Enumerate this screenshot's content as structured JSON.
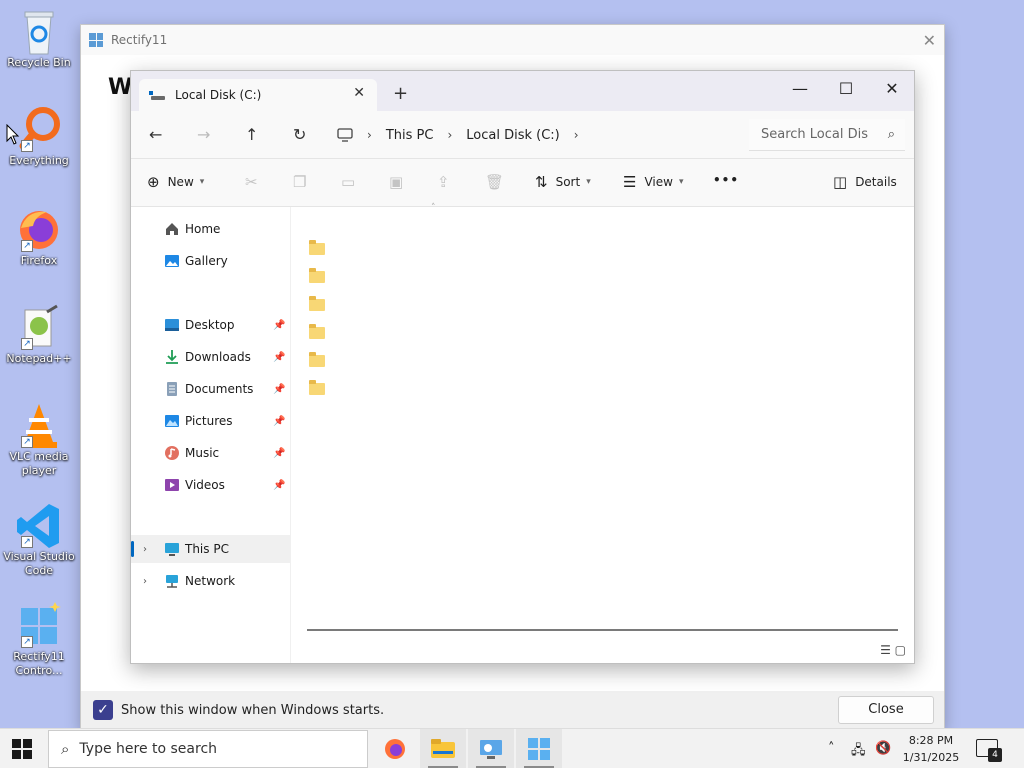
{
  "desktop": {
    "icons": [
      {
        "label": "Recycle Bin"
      },
      {
        "label": "Everything"
      },
      {
        "label": "Firefox"
      },
      {
        "label": "Notepad++"
      },
      {
        "label": "VLC media player"
      },
      {
        "label": "Visual Studio Code"
      },
      {
        "label": "Rectify11 Contro..."
      }
    ]
  },
  "rectify": {
    "title": "Rectify11",
    "heading": "W",
    "show_on_start_label": "Show this window when Windows starts.",
    "close_label": "Close"
  },
  "explorer": {
    "tab_title": "Local Disk (C:)",
    "breadcrumbs": [
      "This PC",
      "Local Disk (C:)"
    ],
    "search_placeholder": "Search Local Dis",
    "toolbar": {
      "new_label": "New",
      "sort_label": "Sort",
      "view_label": "View",
      "more_label": "•••",
      "details_label": "Details"
    },
    "sidebar": {
      "top": [
        {
          "label": "Home"
        },
        {
          "label": "Gallery"
        }
      ],
      "pinned": [
        {
          "label": "Desktop"
        },
        {
          "label": "Downloads"
        },
        {
          "label": "Documents"
        },
        {
          "label": "Pictures"
        },
        {
          "label": "Music"
        },
        {
          "label": "Videos"
        }
      ],
      "drives": [
        {
          "label": "This PC"
        },
        {
          "label": "Network"
        }
      ]
    }
  },
  "taskbar": {
    "search_placeholder": "Type here to search",
    "time": "8:28 PM",
    "date": "1/31/2025",
    "notification_count": "4"
  },
  "colors": {
    "desktop_bg": "#b4c0f0",
    "accent": "#0067c0",
    "checkbox": "#3b3f8f",
    "folder": "#f8d775"
  }
}
